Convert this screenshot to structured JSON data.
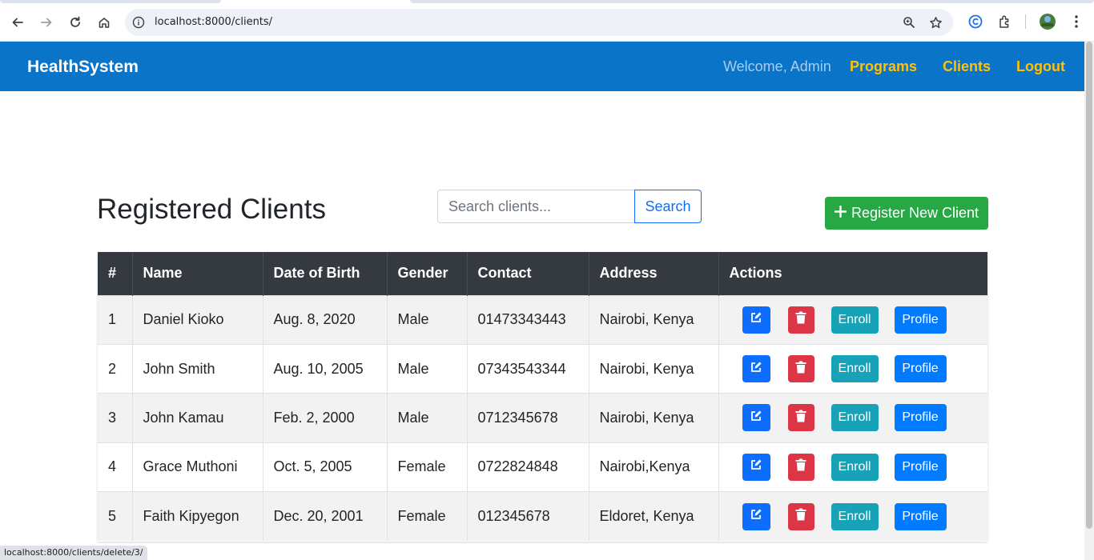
{
  "browser": {
    "url": "localhost:8000/clients/",
    "status_url": "localhost:8000/clients/delete/3/"
  },
  "navbar": {
    "brand": "HealthSystem",
    "welcome": "Welcome, Admin",
    "links": [
      "Programs",
      "Clients",
      "Logout"
    ],
    "background": "#0a74c9",
    "link_color": "#ffc107"
  },
  "page": {
    "title": "Registered Clients",
    "search": {
      "placeholder": "Search clients...",
      "value": "",
      "button_label": "Search"
    },
    "register_button_label": "Register New Client",
    "register_icon": "plus-icon"
  },
  "table": {
    "headers": [
      "#",
      "Name",
      "Date of Birth",
      "Gender",
      "Contact",
      "Address",
      "Actions"
    ],
    "rows": [
      {
        "num": "1",
        "name": "Daniel Kioko",
        "dob": "Aug. 8, 2020",
        "gender": "Male",
        "contact": "01473343443",
        "address": "Nairobi, Kenya"
      },
      {
        "num": "2",
        "name": "John Smith",
        "dob": "Aug. 10, 2005",
        "gender": "Male",
        "contact": "07343543344",
        "address": "Nairobi, Kenya"
      },
      {
        "num": "3",
        "name": "John Kamau",
        "dob": "Feb. 2, 2000",
        "gender": "Male",
        "contact": "0712345678",
        "address": "Nairobi, Kenya"
      },
      {
        "num": "4",
        "name": "Grace Muthoni",
        "dob": "Oct. 5, 2005",
        "gender": "Female",
        "contact": "0722824848",
        "address": "Nairobi,Kenya"
      },
      {
        "num": "5",
        "name": "Faith Kipyegon",
        "dob": "Dec. 20, 2001",
        "gender": "Female",
        "contact": "012345678",
        "address": "Eldoret, Kenya"
      }
    ],
    "action_labels": {
      "enroll": "Enroll",
      "profile": "Profile"
    },
    "action_icons": {
      "edit": "edit-icon",
      "delete": "trash-icon"
    },
    "colors": {
      "edit": "#0d6efd",
      "delete": "#dc3545",
      "enroll": "#17a2b8",
      "profile": "#007bff",
      "header": "#343a40"
    }
  }
}
